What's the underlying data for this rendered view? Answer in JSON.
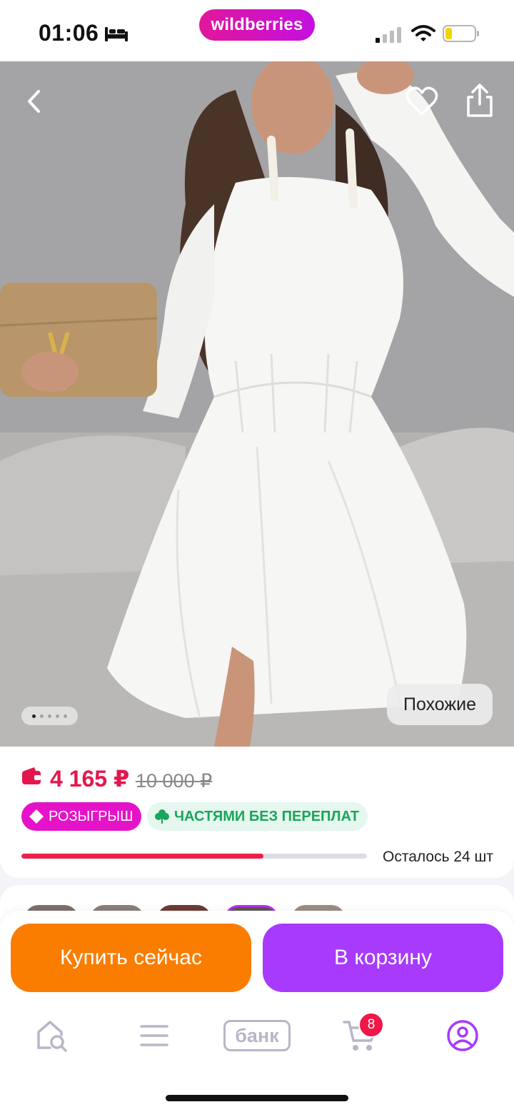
{
  "status_bar": {
    "time": "01:06",
    "brand": "wildberries",
    "icons": [
      "bed-icon",
      "signal-icon",
      "wifi-icon",
      "battery-icon"
    ]
  },
  "product_image": {
    "nav_icons": [
      "back-icon",
      "heart-icon",
      "share-icon"
    ],
    "page_count": 5,
    "active_page": 1,
    "similar_label": "Похожие"
  },
  "price": {
    "current": "4 165 ₽",
    "old": "10 000 ₽",
    "badges": [
      {
        "label": "РОЗЫГРЫШ",
        "icon": "tag-icon",
        "color": "#e413c9"
      },
      {
        "label": "ЧАСТЯМИ БЕЗ ПЕРЕПЛАТ",
        "icon": "clover-icon",
        "color": "#1aa55a"
      }
    ],
    "stock_progress": 0.7,
    "stock_text": "Осталось 24 шт"
  },
  "actions": {
    "buy_now": "Купить сейчас",
    "add_to_cart": "В корзину"
  },
  "tab_bar": {
    "items": [
      {
        "name": "home-search",
        "icon": "home-search-icon"
      },
      {
        "name": "catalog",
        "icon": "menu-icon"
      },
      {
        "name": "bank",
        "label": "банк"
      },
      {
        "name": "cart",
        "icon": "cart-icon",
        "badge": "8"
      },
      {
        "name": "profile",
        "icon": "profile-icon"
      }
    ]
  },
  "colors": {
    "brand": "#c50fe0",
    "price_red": "#e3174c",
    "buy_orange": "#fb7d00",
    "cart_purple": "#a73afd"
  }
}
